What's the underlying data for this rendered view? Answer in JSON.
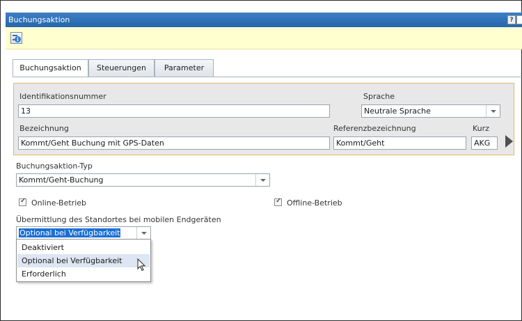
{
  "window": {
    "title": "Buchungsaktion",
    "help_label": "?"
  },
  "toolbar": {
    "info_icon": "list-info-icon",
    "info_glyph": "i"
  },
  "tabs": [
    {
      "label": "Buchungsaktion",
      "active": true
    },
    {
      "label": "Steuerungen",
      "active": false
    },
    {
      "label": "Parameter",
      "active": false
    }
  ],
  "form": {
    "id_label": "Identifikationsnummer",
    "id_value": "13",
    "language_label": "Sprache",
    "language_value": "Neutrale Sprache",
    "name_label": "Bezeichnung",
    "name_value": "Kommt/Geht Buchung mit GPS-Daten",
    "ref_label": "Referenzbezeichnung",
    "ref_value": "Kommt/Geht",
    "short_label": "Kurz",
    "short_value": "AKG",
    "type_label": "Buchungsaktion-Typ",
    "type_value": "Kommt/Geht-Buchung",
    "online_label": "Online-Betrieb",
    "online_checked": true,
    "offline_label": "Offline-Betrieb",
    "offline_checked": true,
    "location_label": "Übermittlung des Standortes bei mobilen Endgeräten",
    "location_value": "Optional bei Verfügbarkeit",
    "location_options": [
      "Deaktiviert",
      "Optional bei Verfügbarkeit",
      "Erforderlich"
    ]
  },
  "colors": {
    "titlebar": "#2f72bd",
    "toolbar": "#ffffd0",
    "group_border": "#e0b870",
    "selection": "#1a6fd4"
  }
}
